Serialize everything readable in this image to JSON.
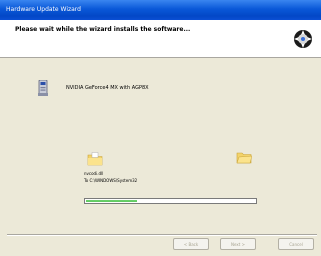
{
  "window": {
    "title": "Hardware Update Wizard"
  },
  "header": {
    "title": "Please wait while the wizard installs the software..."
  },
  "device": {
    "name": "NVIDIA GeForce4 MX with AGP8X"
  },
  "copy": {
    "file_name": "nvcodi.dll",
    "destination_path": "To C:\\WINDOWS\\System32",
    "progress_fraction": 0.3
  },
  "buttons": {
    "back": "< Back",
    "next": "Next >",
    "cancel": "Cancel"
  },
  "colors": {
    "titlebar": "#0a58d8",
    "dialog_bg": "#ece9d8",
    "progress": "#35b635"
  }
}
